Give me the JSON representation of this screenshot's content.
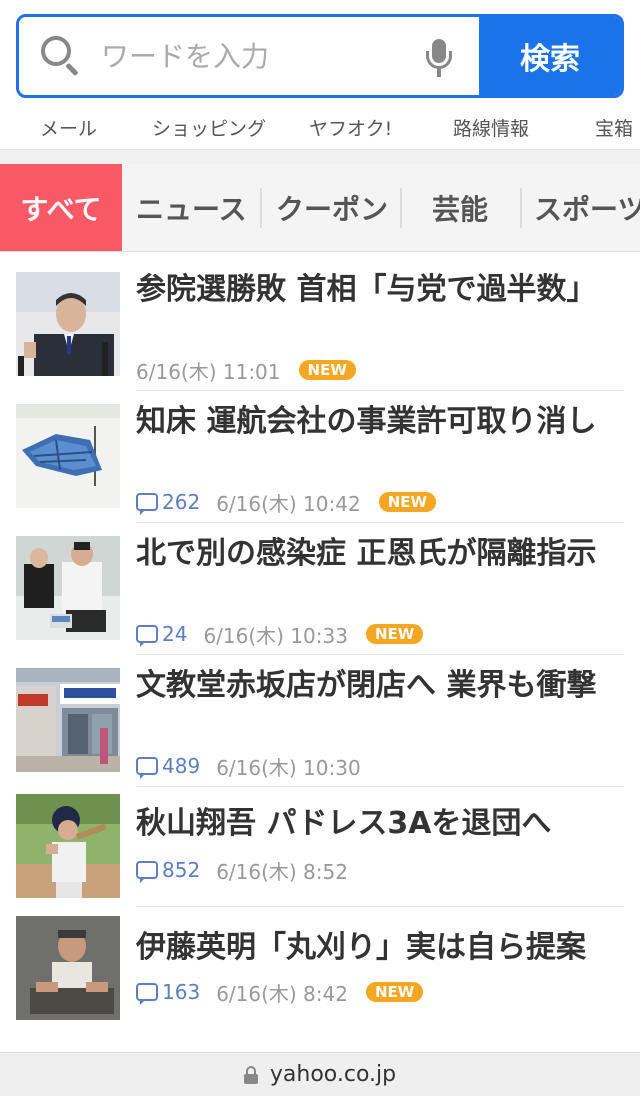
{
  "search": {
    "placeholder": "ワードを入力",
    "button_label": "検索"
  },
  "services": [
    "メール",
    "ショッピング",
    "ヤフオク!",
    "路線情報",
    "宝箱"
  ],
  "tabs": {
    "active": "すべて",
    "items": [
      "ニュース",
      "クーポン",
      "芸能",
      "スポーツ"
    ]
  },
  "news": [
    {
      "headline": "参院選勝敗 首相「与党で過半数」",
      "comments": "",
      "time": "6/16(木) 11:01",
      "badge": "NEW"
    },
    {
      "headline": "知床 運航会社の事業許可取り消し",
      "comments": "262",
      "time": "6/16(木) 10:42",
      "badge": "NEW"
    },
    {
      "headline": "北で別の感染症 正恩氏が隔離指示",
      "comments": "24",
      "time": "6/16(木) 10:33",
      "badge": "NEW"
    },
    {
      "headline": "文教堂赤坂店が閉店へ 業界も衝撃",
      "comments": "489",
      "time": "6/16(木) 10:30",
      "badge": ""
    },
    {
      "headline": "秋山翔吾 パドレス3Aを退団へ",
      "comments": "852",
      "time": "6/16(木) 8:52",
      "badge": ""
    },
    {
      "headline": "伊藤英明「丸刈り」実は自ら提案",
      "comments": "163",
      "time": "6/16(木) 8:42",
      "badge": "NEW"
    }
  ],
  "urlbar": {
    "url": "yahoo.co.jp"
  }
}
